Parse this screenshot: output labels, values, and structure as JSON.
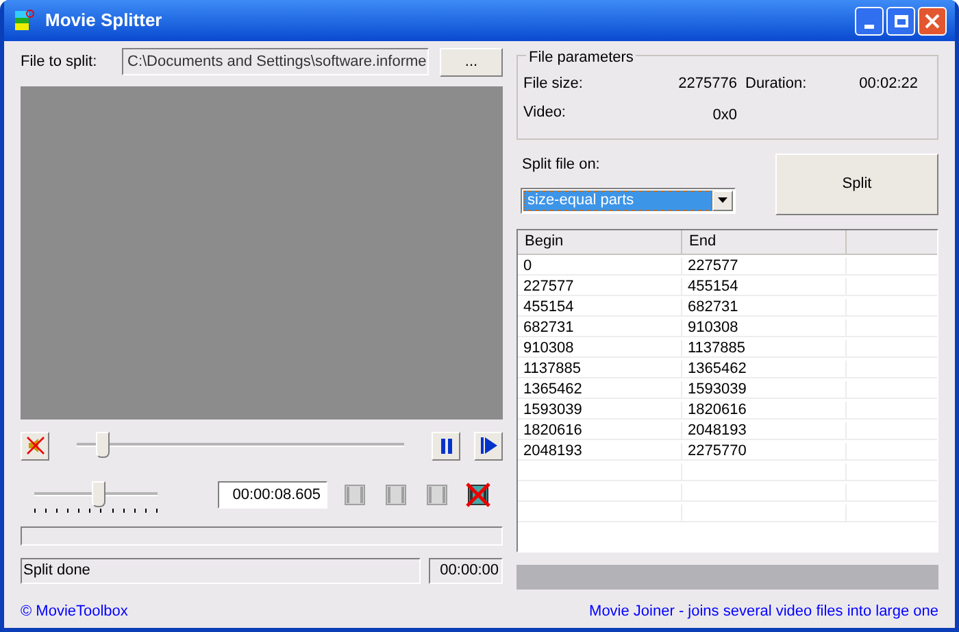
{
  "window": {
    "title": "Movie Splitter"
  },
  "file": {
    "label": "File to split:",
    "value": "C:\\Documents and Settings\\software.informe",
    "browse": "..."
  },
  "player": {
    "position": {
      "level": 0.08
    },
    "volume": {
      "level": 0.52
    },
    "time": "00:00:08.605",
    "muted": true
  },
  "parameters": {
    "title": "File parameters",
    "size_label": "File size:",
    "size": "2275776",
    "duration_label": "Duration:",
    "duration": "00:02:22",
    "video_label": "Video:",
    "video": "0x0"
  },
  "split": {
    "label": "Split file on:",
    "mode": "size-equal parts",
    "button": "Split"
  },
  "table": {
    "columns": [
      "Begin",
      "End"
    ],
    "rows": [
      [
        "0",
        "227577"
      ],
      [
        "227577",
        "455154"
      ],
      [
        "455154",
        "682731"
      ],
      [
        "682731",
        "910308"
      ],
      [
        "910308",
        "1137885"
      ],
      [
        "1137885",
        "1365462"
      ],
      [
        "1365462",
        "1593039"
      ],
      [
        "1593039",
        "1820616"
      ],
      [
        "1820616",
        "2048193"
      ],
      [
        "2048193",
        "2275770"
      ]
    ]
  },
  "status_bar": {
    "message": "Split done",
    "time": "00:00:00"
  },
  "progress": [
    {
      "level": 0
    },
    {
      "level": 1
    }
  ],
  "links": {
    "left": "© MovieToolbox",
    "right": "Movie Joiner - joins several video files into large one"
  }
}
